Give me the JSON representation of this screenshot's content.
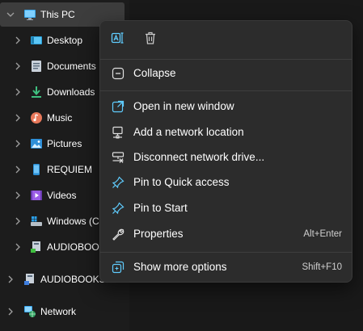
{
  "nav": {
    "items": [
      {
        "label": "This PC",
        "icon": "monitor-icon"
      },
      {
        "label": "Desktop",
        "icon": "desktop-icon"
      },
      {
        "label": "Documents",
        "icon": "documents-icon"
      },
      {
        "label": "Downloads",
        "icon": "download-icon"
      },
      {
        "label": "Music",
        "icon": "music-icon"
      },
      {
        "label": "Pictures",
        "icon": "pictures-icon"
      },
      {
        "label": "REQUIEM",
        "icon": "phone-device-icon"
      },
      {
        "label": "Videos",
        "icon": "videos-icon"
      },
      {
        "label": "Windows (C:)",
        "icon": "windows-drive-icon"
      },
      {
        "label": "AUDIOBOOKS",
        "icon": "network-drive-icon"
      },
      {
        "label": "AUDIOBOOKS",
        "icon": "network-drive-icon"
      },
      {
        "label": "Network",
        "icon": "network-icon"
      }
    ]
  },
  "menu": {
    "quick_actions": [
      {
        "icon": "rename-icon"
      },
      {
        "icon": "delete-icon"
      }
    ],
    "items": [
      {
        "label": "Collapse",
        "icon": "collapse-icon",
        "shortcut": ""
      },
      {
        "label": "Open in new window",
        "icon": "open-new-window-icon",
        "shortcut": ""
      },
      {
        "label": "Add a network location",
        "icon": "add-network-location-icon",
        "shortcut": ""
      },
      {
        "label": "Disconnect network drive...",
        "icon": "disconnect-drive-icon",
        "shortcut": ""
      },
      {
        "label": "Pin to Quick access",
        "icon": "pin-icon",
        "shortcut": ""
      },
      {
        "label": "Pin to Start",
        "icon": "pin-icon",
        "shortcut": ""
      },
      {
        "label": "Properties",
        "icon": "wrench-icon",
        "shortcut": "Alt+Enter"
      },
      {
        "label": "Show more options",
        "icon": "show-more-options-icon",
        "shortcut": "Shift+F10"
      }
    ]
  },
  "colors": {
    "background": "#1c1c1c",
    "menu_background": "#2c2c2c",
    "selection": "#3d3d3d",
    "accent": "#60cdff"
  }
}
